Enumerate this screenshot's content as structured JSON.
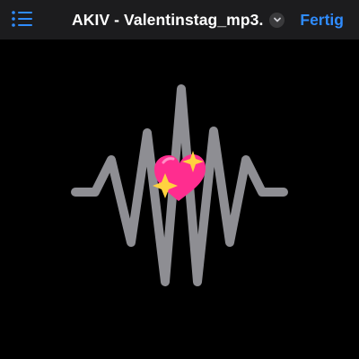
{
  "header": {
    "title": "AKIV - Valentinstag_mp3.",
    "done_label": "Fertig",
    "list_icon": "list-bullet-icon",
    "title_menu_icon": "chevron-down-icon"
  },
  "artwork": {
    "waveform_icon": "waveform-icon",
    "emoji": "sparkling-heart-icon"
  },
  "colors": {
    "background": "#000000",
    "toolbar": "#1c1c1e",
    "accent": "#2f8cff",
    "waveform": "#8e8e93",
    "heart": "#ff2d8f"
  }
}
